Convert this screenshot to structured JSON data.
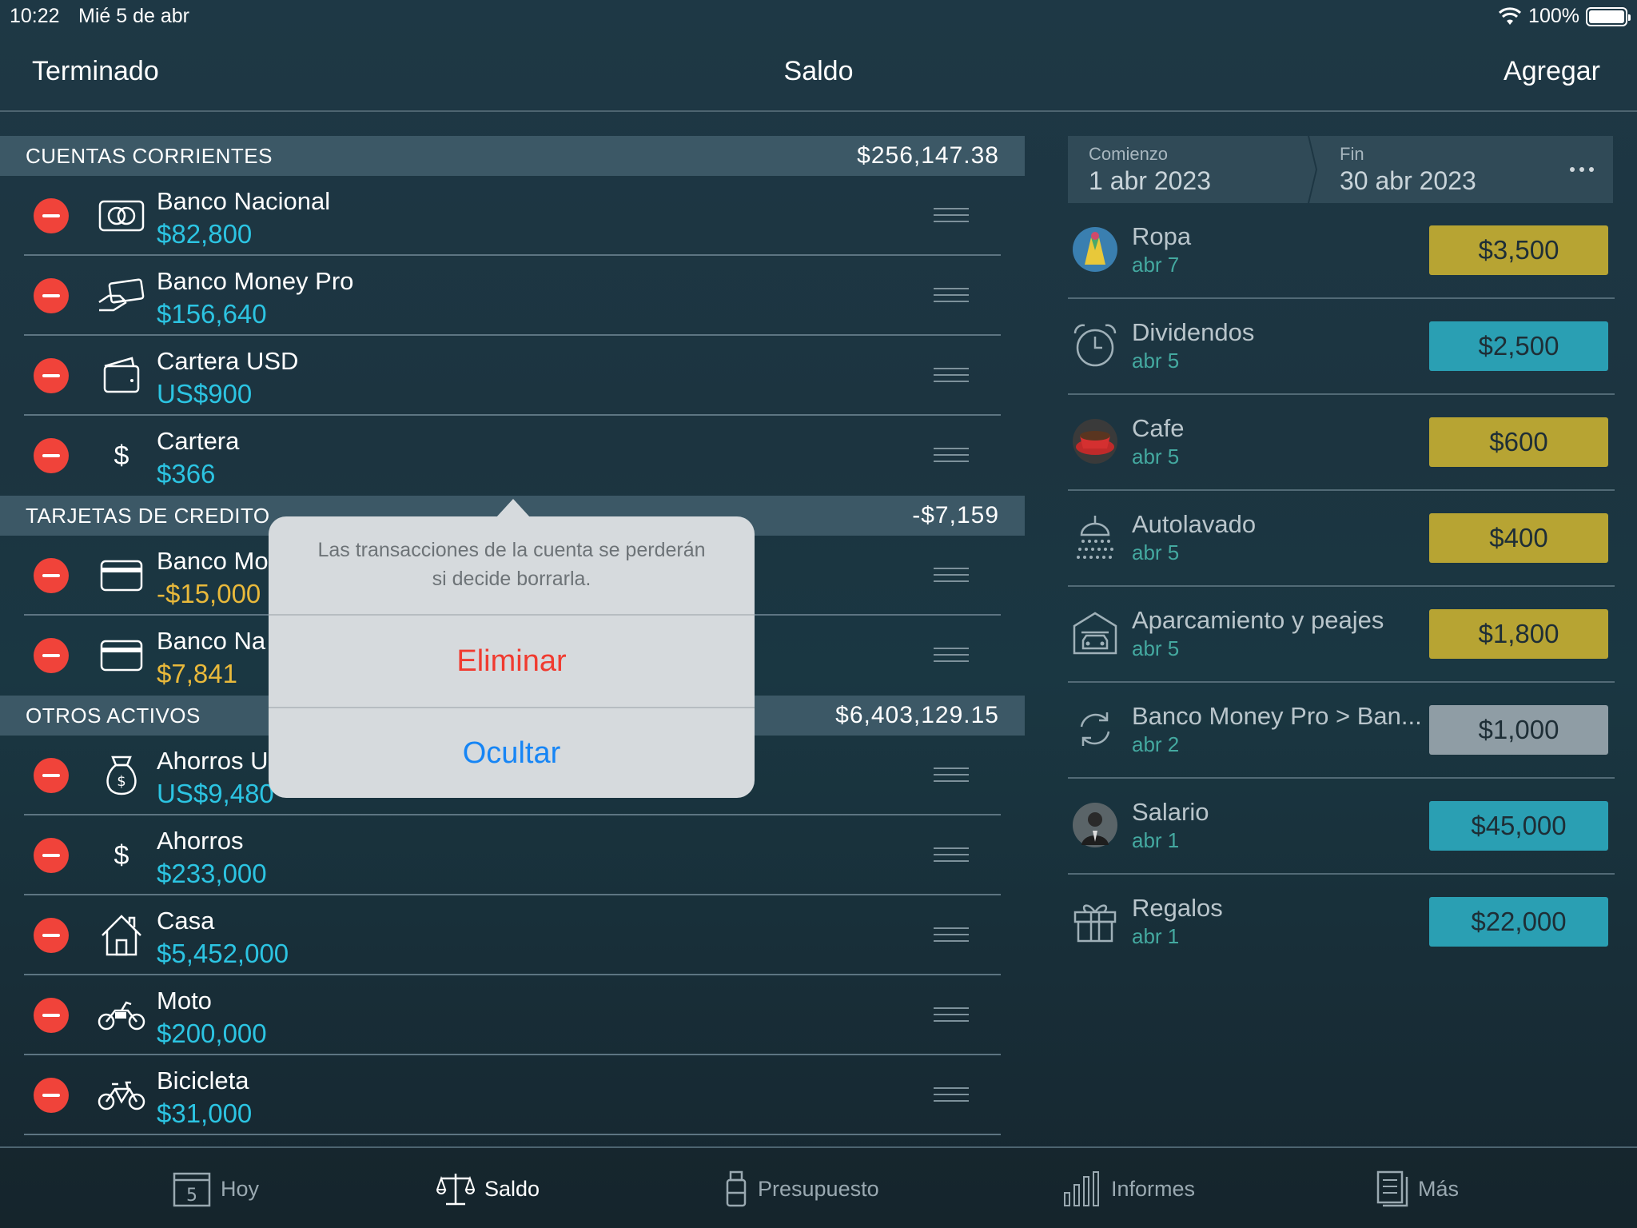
{
  "status": {
    "time": "10:22",
    "date": "Mié 5 de abr",
    "battery": "100%"
  },
  "nav": {
    "left": "Terminado",
    "title": "Saldo",
    "right": "Agregar"
  },
  "sections": [
    {
      "title": "CUENTAS CORRIENTES",
      "total": "$256,147.38",
      "items": [
        {
          "name": "Banco Nacional",
          "amount": "$82,800",
          "icon": "banknote-icon"
        },
        {
          "name": "Banco Money Pro",
          "amount": "$156,640",
          "icon": "card-hand-icon"
        },
        {
          "name": "Cartera USD",
          "amount": "US$900",
          "icon": "wallet-icon"
        },
        {
          "name": "Cartera",
          "amount": "$366",
          "icon": "dollar-icon"
        }
      ]
    },
    {
      "title": "TARJETAS DE CREDITO",
      "total": "-$7,159",
      "items": [
        {
          "name": "Banco Mo",
          "amount": "-$15,000",
          "icon": "credit-card-icon"
        },
        {
          "name": "Banco Na",
          "amount": "$7,841",
          "icon": "credit-card-icon"
        }
      ]
    },
    {
      "title": "OTROS ACTIVOS",
      "total": "$6,403,129.15",
      "items": [
        {
          "name": "Ahorros U",
          "amount": "US$9,480",
          "icon": "money-bag-icon"
        },
        {
          "name": "Ahorros",
          "amount": "$233,000",
          "icon": "dollar-icon"
        },
        {
          "name": "Casa",
          "amount": "$5,452,000",
          "icon": "house-icon"
        },
        {
          "name": "Moto",
          "amount": "$200,000",
          "icon": "motorcycle-icon"
        },
        {
          "name": "Bicicleta",
          "amount": "$31,000",
          "icon": "bicycle-icon"
        }
      ]
    }
  ],
  "period": {
    "start_label": "Comienzo",
    "start_value": "1 abr 2023",
    "end_label": "Fin",
    "end_value": "30 abr 2023"
  },
  "transactions": [
    {
      "name": "Ropa",
      "date": "abr 7",
      "amount": "$3,500",
      "color": "#b7a433",
      "icon": "clothing-icon"
    },
    {
      "name": "Dividendos",
      "date": "abr 5",
      "amount": "$2,500",
      "color": "#2a9fb3",
      "icon": "alarm-clock-icon"
    },
    {
      "name": "Cafe",
      "date": "abr 5",
      "amount": "$600",
      "color": "#b7a433",
      "icon": "coffee-cup-icon"
    },
    {
      "name": "Autolavado",
      "date": "abr 5",
      "amount": "$400",
      "color": "#b7a433",
      "icon": "shower-icon"
    },
    {
      "name": "Aparcamiento y peajes",
      "date": "abr 5",
      "amount": "$1,800",
      "color": "#b7a433",
      "icon": "garage-icon"
    },
    {
      "name": "Banco Money Pro > Ban...",
      "date": "abr 2",
      "amount": "$1,000",
      "color": "#8f9da5",
      "icon": "transfer-icon"
    },
    {
      "name": "Salario",
      "date": "abr 1",
      "amount": "$45,000",
      "color": "#2a9fb3",
      "icon": "person-photo-icon"
    },
    {
      "name": "Regalos",
      "date": "abr 1",
      "amount": "$22,000",
      "color": "#2a9fb3",
      "icon": "gift-icon"
    }
  ],
  "popover": {
    "message_line1": "Las transacciones de la cuenta se perderán",
    "message_line2": "si decide borrarla.",
    "delete": "Eliminar",
    "hide": "Ocultar"
  },
  "tabs": [
    {
      "label": "Hoy",
      "badge": "5",
      "active": false
    },
    {
      "label": "Saldo",
      "active": true
    },
    {
      "label": "Presupuesto",
      "active": false
    },
    {
      "label": "Informes",
      "active": false
    },
    {
      "label": "Más",
      "active": false
    }
  ]
}
